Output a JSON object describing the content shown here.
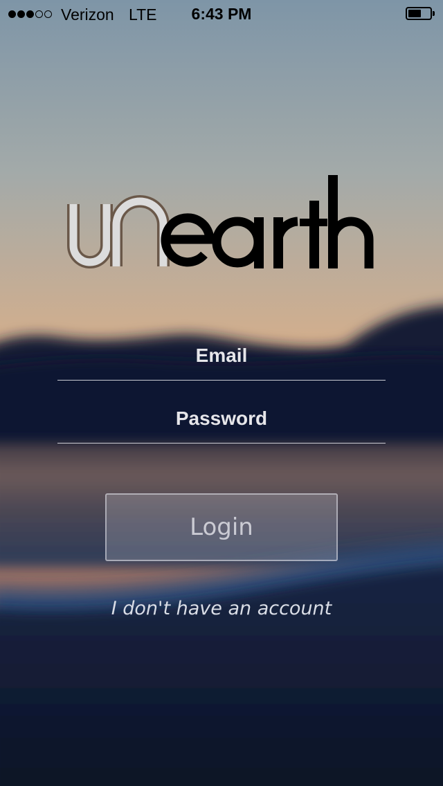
{
  "status_bar": {
    "signal_bars_filled": 3,
    "signal_bars_total": 5,
    "carrier": "Verizon",
    "network": "LTE",
    "time": "6:43 PM",
    "battery_level": 0.6
  },
  "app": {
    "logo_text": "unearth"
  },
  "login_form": {
    "email_placeholder": "Email",
    "email_value": "",
    "password_placeholder": "Password",
    "password_value": "",
    "login_label": "Login",
    "no_account_label": "I don't have an account"
  },
  "colors": {
    "sky_top": "#7f97aa",
    "sky_sunset": "#e4a978",
    "mountains": "#121a33",
    "shore": "#0d1428",
    "input_text": "#e6e6ea"
  },
  "icons": {
    "battery": "battery-icon",
    "signal": "signal-strength-icon"
  }
}
